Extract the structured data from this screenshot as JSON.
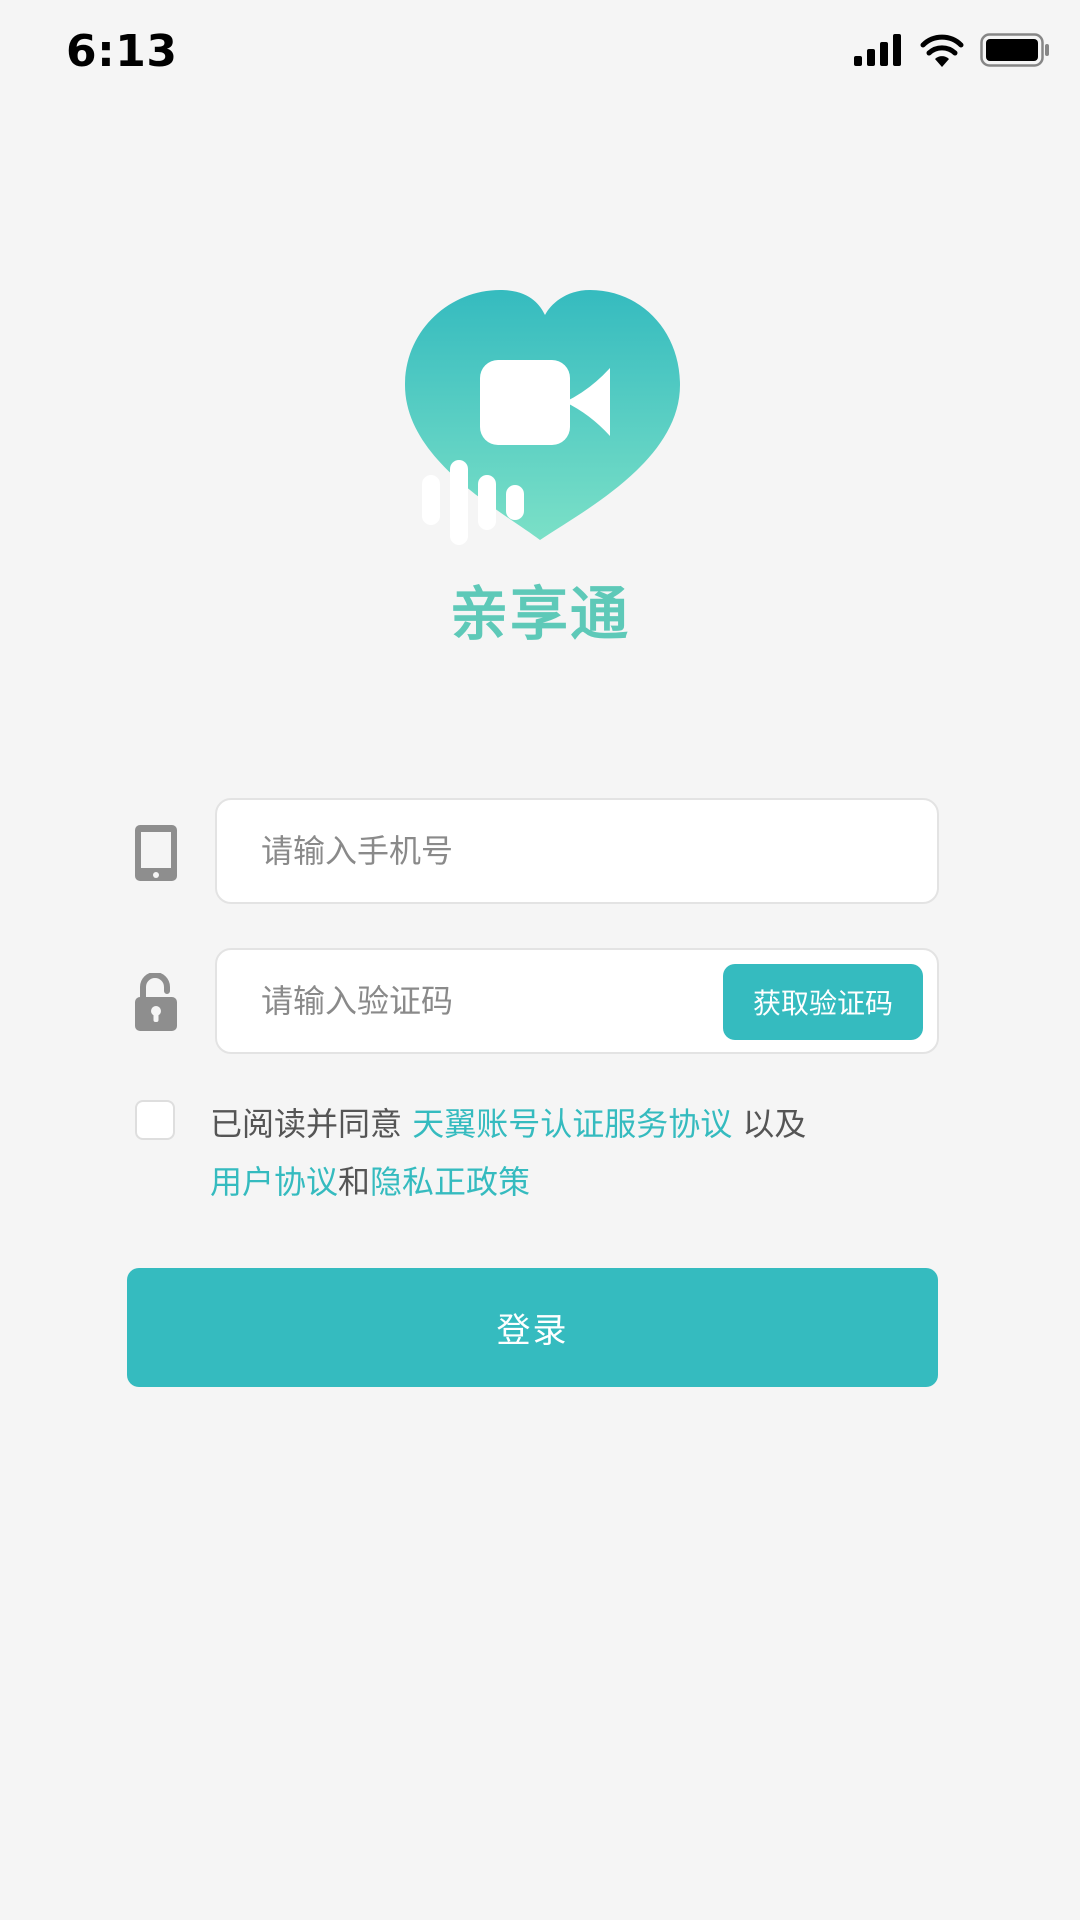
{
  "status_bar": {
    "time": "6:13",
    "icons": [
      "signal-icon",
      "wifi-icon",
      "battery-icon"
    ]
  },
  "app": {
    "name": "亲享通",
    "logo_icon": "heart-video-logo",
    "colors": {
      "accent": "#35bbbf",
      "logo_top": "#35bbbf",
      "logo_bottom": "#7be0c7",
      "title": "#5ec9b8"
    }
  },
  "form": {
    "phone": {
      "icon": "phone-icon",
      "placeholder": "请输入手机号",
      "value": ""
    },
    "code": {
      "icon": "unlock-icon",
      "placeholder": "请输入验证码",
      "value": "",
      "button_label": "获取验证码"
    }
  },
  "agreement": {
    "checked": false,
    "prefix": "已阅读并同意 ",
    "link1": "天翼账号认证服务协议",
    "middle": " 以及",
    "link2": "用户协议",
    "conjunction": "和",
    "link3": "隐私正政策"
  },
  "login_button": {
    "label": "登录"
  }
}
